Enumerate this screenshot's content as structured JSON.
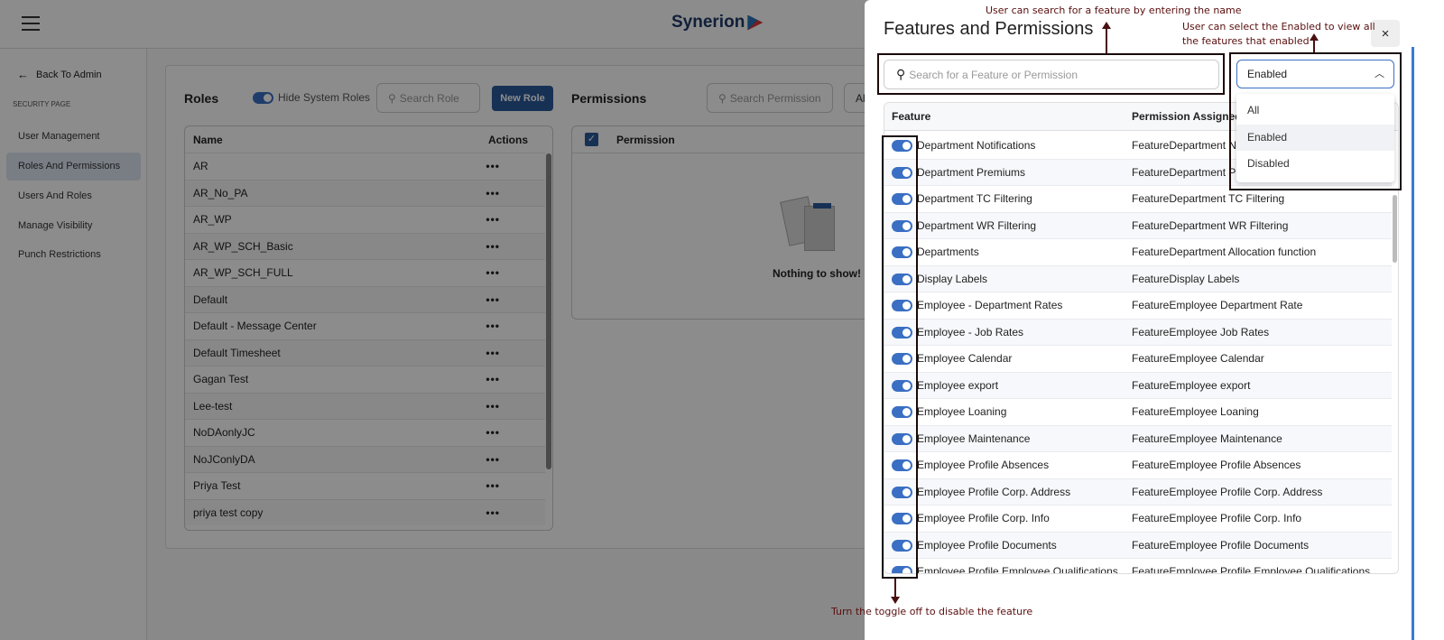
{
  "header": {
    "logo": "Synerion",
    "menu_icon": "hamburger-icon"
  },
  "sidebar": {
    "back": "Back To Admin",
    "section": "SECURITY PAGE",
    "items": [
      {
        "label": "User Management"
      },
      {
        "label": "Roles And Permissions",
        "active": true
      },
      {
        "label": "Users And Roles"
      },
      {
        "label": "Manage Visibility"
      },
      {
        "label": "Punch Restrictions"
      }
    ]
  },
  "roles": {
    "title": "Roles",
    "hide_system": "Hide System Roles",
    "search_placeholder": "Search Role",
    "new_role": "New Role",
    "col_name": "Name",
    "col_actions": "Actions",
    "actions_glyph": "•••",
    "items": [
      "AR",
      "AR_No_PA",
      "AR_WP",
      "AR_WP_SCH_Basic",
      "AR_WP_SCH_FULL",
      "Default",
      "Default - Message Center",
      "Default Timesheet",
      "Gagan Test",
      "Lee-test",
      "NoDAonlyJC",
      "NoJConlyDA",
      "Priya Test",
      "priya test copy"
    ]
  },
  "permissions": {
    "title": "Permissions",
    "search_placeholder": "Search Permission",
    "filter_partial": "Al",
    "col_permission": "Permission",
    "empty": "Nothing to show!"
  },
  "panel": {
    "title": "Features and Permissions",
    "close": "×",
    "search_placeholder": "Search for a Feature or Permission",
    "filter_value": "Enabled",
    "filter_options": [
      "All",
      "Enabled",
      "Disabled"
    ],
    "filter_selected": "Enabled",
    "col_feature": "Feature",
    "col_permission": "Permission Assigned",
    "rows": [
      {
        "feature": "Department Notifications",
        "permission": "FeatureDepartment No",
        "enabled": true
      },
      {
        "feature": "Department Premiums",
        "permission": "FeatureDepartment Pre",
        "enabled": true
      },
      {
        "feature": "Department TC Filtering",
        "permission": "FeatureDepartment TC Filtering",
        "enabled": true
      },
      {
        "feature": "Department WR Filtering",
        "permission": "FeatureDepartment WR Filtering",
        "enabled": true
      },
      {
        "feature": "Departments",
        "permission": "FeatureDepartment Allocation function",
        "enabled": true
      },
      {
        "feature": "Display Labels",
        "permission": "FeatureDisplay Labels",
        "enabled": true
      },
      {
        "feature": "Employee - Department Rates",
        "permission": "FeatureEmployee Department Rate",
        "enabled": true
      },
      {
        "feature": "Employee - Job Rates",
        "permission": "FeatureEmployee Job Rates",
        "enabled": true
      },
      {
        "feature": "Employee Calendar",
        "permission": "FeatureEmployee Calendar",
        "enabled": true
      },
      {
        "feature": "Employee export",
        "permission": "FeatureEmployee export",
        "enabled": true
      },
      {
        "feature": "Employee Loaning",
        "permission": "FeatureEmployee Loaning",
        "enabled": true
      },
      {
        "feature": "Employee Maintenance",
        "permission": "FeatureEmployee Maintenance",
        "enabled": true
      },
      {
        "feature": "Employee Profile Absences",
        "permission": "FeatureEmployee Profile Absences",
        "enabled": true
      },
      {
        "feature": "Employee Profile Corp. Address",
        "permission": "FeatureEmployee Profile Corp. Address",
        "enabled": true
      },
      {
        "feature": "Employee Profile Corp. Info",
        "permission": "FeatureEmployee Profile Corp. Info",
        "enabled": true
      },
      {
        "feature": "Employee Profile Documents",
        "permission": "FeatureEmployee Profile Documents",
        "enabled": true
      },
      {
        "feature": "Employee Profile Employee Qualifications",
        "permission": "FeatureEmployee Profile Employee Qualifications",
        "enabled": true
      }
    ]
  },
  "annotations": {
    "search": "User can search for a feature by entering the name",
    "filter_line1": "User can select the Enabled to view all",
    "filter_line2": "the features that enabled",
    "toggle": "Turn the toggle off to disable the feature"
  },
  "colors": {
    "accent": "#2a5a9c",
    "toggle": "#3a6fc4",
    "annotation": "#5a0f0f"
  }
}
